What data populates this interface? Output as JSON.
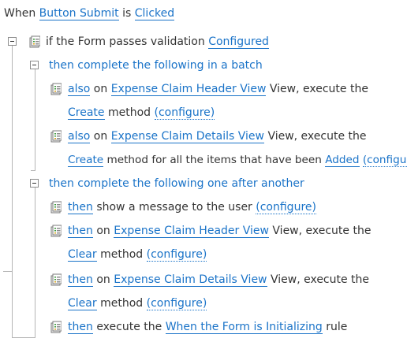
{
  "event": {
    "prefix": "When",
    "control": "Button Submit",
    "mid": "is",
    "action": "Clicked"
  },
  "condition": {
    "text": "if the Form passes validation",
    "link": "Configured"
  },
  "batch": {
    "title": "then complete the following in a batch",
    "actions": [
      {
        "connector": "also",
        "pre": "on",
        "view": "Expense Claim Header View",
        "post": "View, execute the",
        "method": "Create",
        "method_text": "method",
        "configure": "(configure)"
      },
      {
        "connector": "also",
        "pre": "on",
        "view": "Expense Claim Details View",
        "post": "View, execute the",
        "method": "Create",
        "method_text": "method for all the items that have been",
        "state": "Added",
        "configure": "(configure)"
      }
    ]
  },
  "sequence": {
    "title": "then complete the following one after another",
    "actions": [
      {
        "connector": "then",
        "text": "show a message to the user",
        "configure": "(configure)"
      },
      {
        "connector": "then",
        "pre": "on",
        "view": "Expense Claim Header View",
        "post": "View, execute the",
        "method": "Clear",
        "method_text": "method",
        "configure": "(configure)"
      },
      {
        "connector": "then",
        "pre": "on",
        "view": "Expense Claim Details View",
        "post": "View, execute the",
        "method": "Clear",
        "method_text": "method",
        "configure": "(configure)"
      },
      {
        "connector": "then",
        "pre": "execute the",
        "rule": "When the Form is Initializing",
        "post": "rule"
      }
    ]
  },
  "colors": {
    "link": "#1a73c8",
    "text": "#333333",
    "tree_line": "#b5b5b5"
  },
  "icons": {
    "rule_item": "rule-document-icon",
    "collapse": "collapse-minus-icon"
  }
}
